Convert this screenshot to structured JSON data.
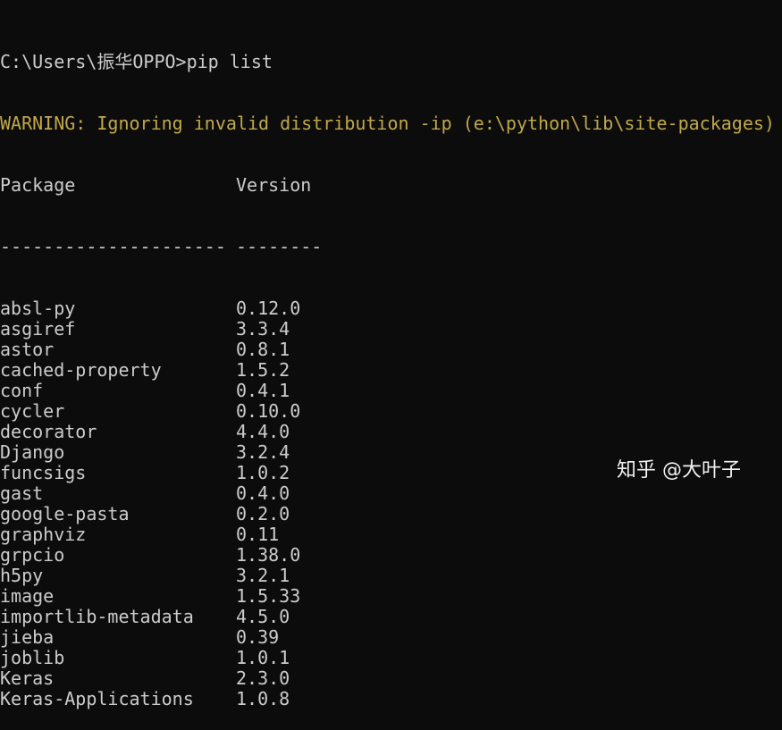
{
  "terminal": {
    "prompt": "C:\\Users\\振华OPPO>pip list",
    "warning": "WARNING: Ignoring invalid distribution -ip (e:\\python\\lib\\site-packages)",
    "header": {
      "package": "Package",
      "version": "Version"
    },
    "separator": {
      "package": "---------------------",
      "version": "--------"
    },
    "rows": [
      {
        "package": "absl-py",
        "version": "0.12.0"
      },
      {
        "package": "asgiref",
        "version": "3.3.4"
      },
      {
        "package": "astor",
        "version": "0.8.1"
      },
      {
        "package": "cached-property",
        "version": "1.5.2"
      },
      {
        "package": "conf",
        "version": "0.4.1"
      },
      {
        "package": "cycler",
        "version": "0.10.0"
      },
      {
        "package": "decorator",
        "version": "4.4.0"
      },
      {
        "package": "Django",
        "version": "3.2.4"
      },
      {
        "package": "funcsigs",
        "version": "1.0.2"
      },
      {
        "package": "gast",
        "version": "0.4.0"
      },
      {
        "package": "google-pasta",
        "version": "0.2.0"
      },
      {
        "package": "graphviz",
        "version": "0.11"
      },
      {
        "package": "grpcio",
        "version": "1.38.0"
      },
      {
        "package": "h5py",
        "version": "3.2.1"
      },
      {
        "package": "image",
        "version": "1.5.33"
      },
      {
        "package": "importlib-metadata",
        "version": "4.5.0"
      },
      {
        "package": "jieba",
        "version": "0.39"
      },
      {
        "package": "joblib",
        "version": "1.0.1"
      },
      {
        "package": "Keras",
        "version": "2.3.0"
      },
      {
        "package": "Keras-Applications",
        "version": "1.0.8"
      }
    ]
  },
  "watermark": "知乎 @大叶子"
}
